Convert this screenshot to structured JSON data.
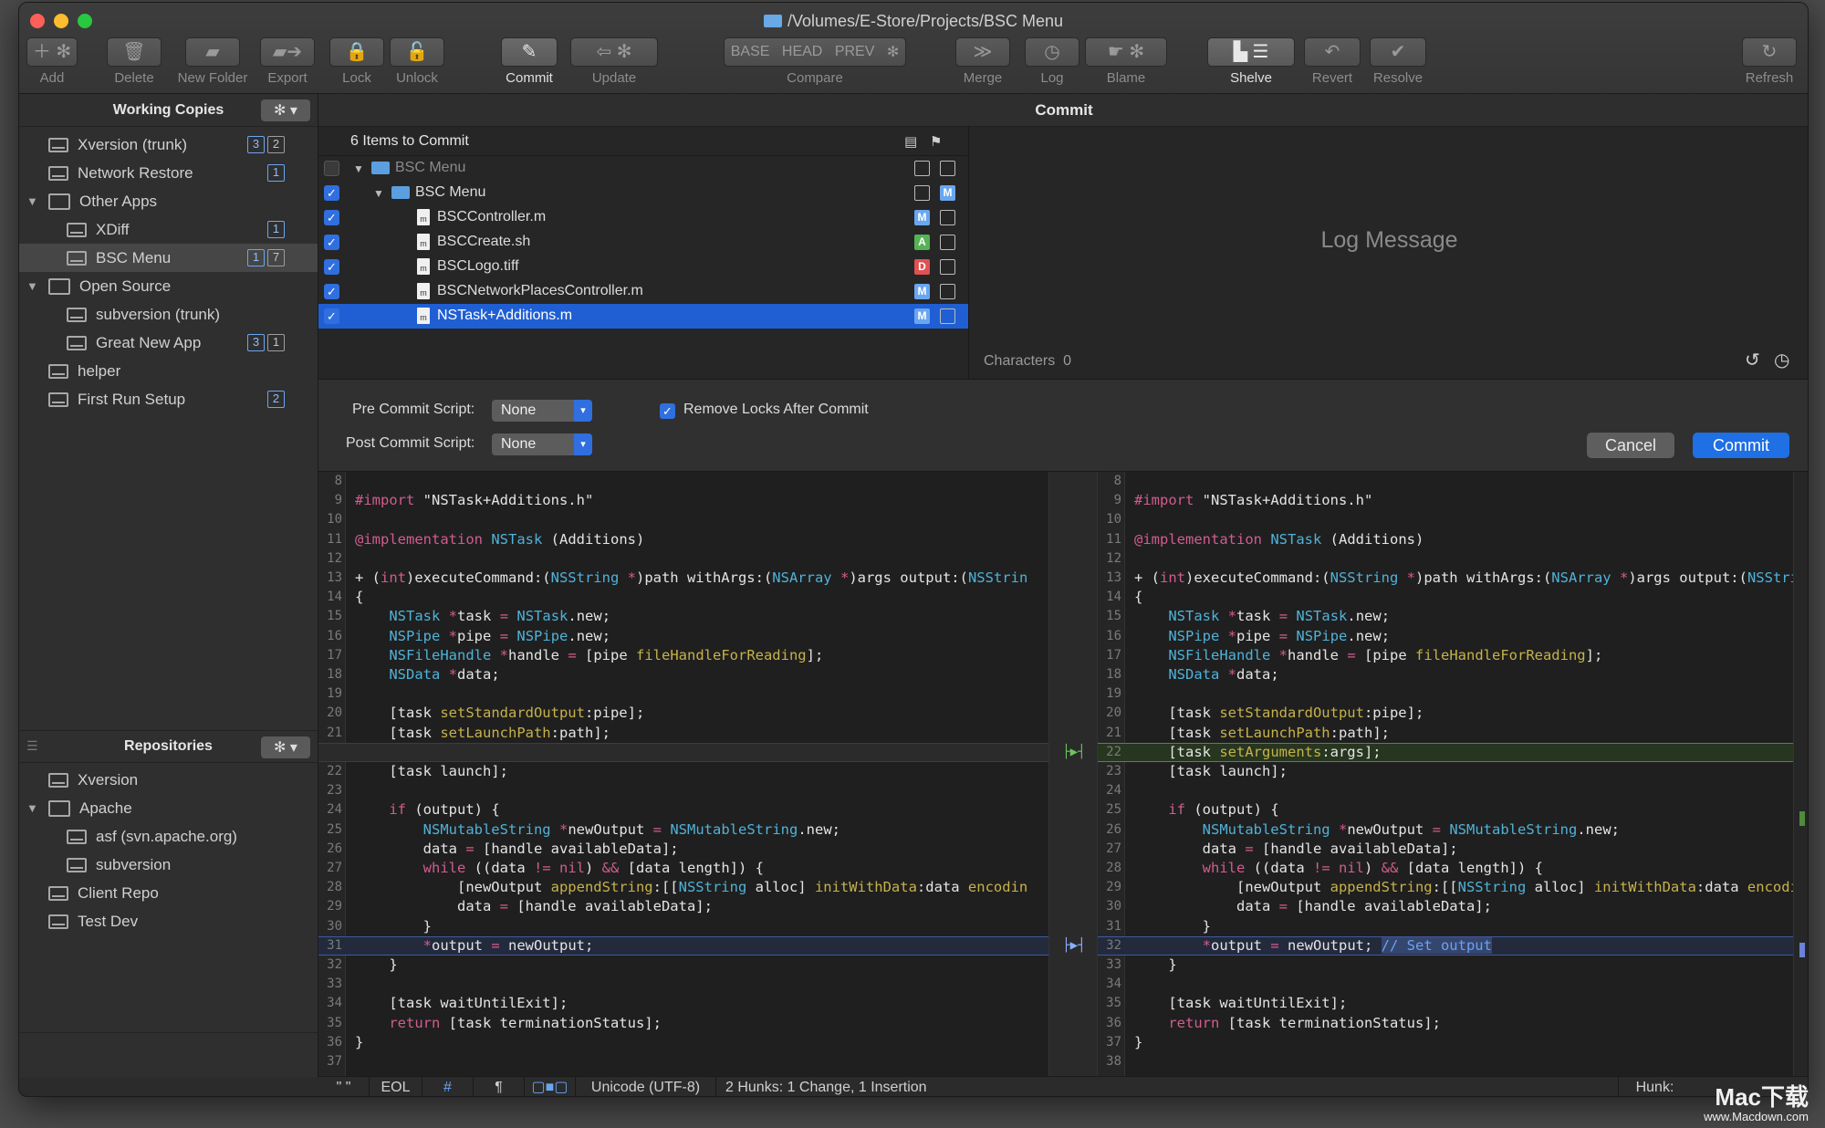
{
  "window": {
    "title": "/Volumes/E-Store/Projects/BSC Menu"
  },
  "toolbar": [
    {
      "id": "add",
      "label": "Add",
      "on": false
    },
    {
      "id": "delete",
      "label": "Delete",
      "on": false
    },
    {
      "id": "new_folder",
      "label": "New Folder",
      "on": false
    },
    {
      "id": "export",
      "label": "Export",
      "on": false
    },
    {
      "id": "lock",
      "label": "Lock",
      "on": false
    },
    {
      "id": "unlock",
      "label": "Unlock",
      "on": false
    },
    {
      "id": "commit",
      "label": "Commit",
      "on": true
    },
    {
      "id": "update",
      "label": "Update",
      "on": false
    },
    {
      "id": "compare",
      "label": "Compare",
      "on": false
    },
    {
      "id": "merge",
      "label": "Merge",
      "on": false
    },
    {
      "id": "log",
      "label": "Log",
      "on": false
    },
    {
      "id": "blame",
      "label": "Blame",
      "on": false
    },
    {
      "id": "shelve",
      "label": "Shelve",
      "on": true
    },
    {
      "id": "revert",
      "label": "Revert",
      "on": false
    },
    {
      "id": "resolve",
      "label": "Resolve",
      "on": false
    },
    {
      "id": "refresh",
      "label": "Refresh",
      "on": false
    }
  ],
  "compare_buttons": [
    "BASE",
    "HEAD",
    "PREV"
  ],
  "sidebar": {
    "working_copies_title": "Working Copies",
    "working_copies": [
      {
        "label": "Xversion (trunk)",
        "level": 0,
        "kind": "drive",
        "badges": [
          "3",
          "2"
        ],
        "disclosure": ""
      },
      {
        "label": "Network Restore",
        "level": 0,
        "kind": "drive",
        "badges": [
          "1"
        ],
        "disclosure": ""
      },
      {
        "label": "Other Apps",
        "level": 0,
        "kind": "folder",
        "badges": [],
        "disclosure": "▼"
      },
      {
        "label": "XDiff",
        "level": 1,
        "kind": "drive",
        "badges": [
          "1"
        ],
        "disclosure": ""
      },
      {
        "label": "BSC Menu",
        "level": 1,
        "kind": "drive",
        "badges": [
          "1",
          "7"
        ],
        "disclosure": "",
        "selected": true
      },
      {
        "label": "Open Source",
        "level": 0,
        "kind": "folder",
        "badges": [],
        "disclosure": "▼"
      },
      {
        "label": "subversion (trunk)",
        "level": 1,
        "kind": "drive",
        "badges": [],
        "disclosure": ""
      },
      {
        "label": "Great New App",
        "level": 1,
        "kind": "drive",
        "badges": [
          "3",
          "1"
        ],
        "disclosure": ""
      },
      {
        "label": "helper",
        "level": 0,
        "kind": "drive",
        "badges": [],
        "disclosure": ""
      },
      {
        "label": "First Run Setup",
        "level": 0,
        "kind": "drive",
        "badges": [
          "2"
        ],
        "disclosure": ""
      }
    ],
    "repositories_title": "Repositories",
    "repositories": [
      {
        "label": "Xversion",
        "level": 0,
        "kind": "drive",
        "disclosure": ""
      },
      {
        "label": "Apache",
        "level": 0,
        "kind": "folder",
        "disclosure": "▼"
      },
      {
        "label": "asf (svn.apache.org)",
        "level": 1,
        "kind": "drive",
        "disclosure": ""
      },
      {
        "label": "subversion",
        "level": 1,
        "kind": "drive",
        "disclosure": ""
      },
      {
        "label": "Client Repo",
        "level": 0,
        "kind": "drive",
        "disclosure": ""
      },
      {
        "label": "Test Dev",
        "level": 0,
        "kind": "drive",
        "disclosure": ""
      }
    ]
  },
  "main": {
    "title": "Commit",
    "items_header": "6 Items to Commit",
    "items": [
      {
        "name": "BSC Menu",
        "level": 0,
        "kind": "folder",
        "checked": false,
        "status": "",
        "dim": true
      },
      {
        "name": "BSC Menu",
        "level": 1,
        "kind": "folder",
        "checked": true,
        "status": "M",
        "status_col": 2
      },
      {
        "name": "BSCController.m",
        "level": 2,
        "kind": "file",
        "checked": true,
        "status": "M",
        "status_col": 1
      },
      {
        "name": "BSCCreate.sh",
        "level": 2,
        "kind": "file",
        "checked": true,
        "status": "A",
        "status_col": 1
      },
      {
        "name": "BSCLogo.tiff",
        "level": 2,
        "kind": "file",
        "checked": true,
        "status": "D",
        "status_col": 1
      },
      {
        "name": "BSCNetworkPlacesController.m",
        "level": 2,
        "kind": "file",
        "checked": true,
        "status": "M",
        "status_col": 1
      },
      {
        "name": "NSTask+Additions.m",
        "level": 2,
        "kind": "file",
        "checked": true,
        "status": "M",
        "status_col": 1,
        "selected": true
      }
    ],
    "log_placeholder": "Log Message",
    "characters_label": "Characters",
    "characters_count": "0",
    "pre_commit_label": "Pre Commit Script:",
    "pre_commit_value": "None",
    "post_commit_label": "Post Commit Script:",
    "post_commit_value": "None",
    "remove_locks_label": "Remove Locks After Commit",
    "cancel_label": "Cancel",
    "commit_label": "Commit"
  },
  "diff": {
    "left": [
      {
        "n": "8",
        "t": ""
      },
      {
        "n": "9",
        "t": "#import \"NSTask+Additions.h\""
      },
      {
        "n": "10",
        "t": ""
      },
      {
        "n": "11",
        "t": "@implementation NSTask (Additions)"
      },
      {
        "n": "12",
        "t": ""
      },
      {
        "n": "13",
        "t": "+ (int)executeCommand:(NSString *)path withArgs:(NSArray *)args output:(NSStrin"
      },
      {
        "n": "14",
        "t": "{"
      },
      {
        "n": "15",
        "t": "    NSTask *task = NSTask.new;"
      },
      {
        "n": "16",
        "t": "    NSPipe *pipe = NSPipe.new;"
      },
      {
        "n": "17",
        "t": "    NSFileHandle *handle = [pipe fileHandleForReading];"
      },
      {
        "n": "18",
        "t": "    NSData *data;"
      },
      {
        "n": "19",
        "t": ""
      },
      {
        "n": "20",
        "t": "    [task setStandardOutput:pipe];"
      },
      {
        "n": "21",
        "t": "    [task setLaunchPath:path];"
      },
      {
        "n": "",
        "t": "",
        "ph": true
      },
      {
        "n": "22",
        "t": "    [task launch];"
      },
      {
        "n": "23",
        "t": ""
      },
      {
        "n": "24",
        "t": "    if (output) {"
      },
      {
        "n": "25",
        "t": "        NSMutableString *newOutput = NSMutableString.new;"
      },
      {
        "n": "26",
        "t": "        data = [handle availableData];"
      },
      {
        "n": "27",
        "t": "        while ((data != nil) && [data length]) {"
      },
      {
        "n": "28",
        "t": "            [newOutput appendString:[[NSString alloc] initWithData:data encodin"
      },
      {
        "n": "29",
        "t": "            data = [handle availableData];"
      },
      {
        "n": "30",
        "t": "        }"
      },
      {
        "n": "31",
        "t": "        *output = newOutput;",
        "chg": true
      },
      {
        "n": "32",
        "t": "    }"
      },
      {
        "n": "33",
        "t": ""
      },
      {
        "n": "34",
        "t": "    [task waitUntilExit];"
      },
      {
        "n": "35",
        "t": "    return [task terminationStatus];"
      },
      {
        "n": "36",
        "t": "}"
      },
      {
        "n": "37",
        "t": ""
      }
    ],
    "right": [
      {
        "n": "8",
        "t": ""
      },
      {
        "n": "9",
        "t": "#import \"NSTask+Additions.h\""
      },
      {
        "n": "10",
        "t": ""
      },
      {
        "n": "11",
        "t": "@implementation NSTask (Additions)"
      },
      {
        "n": "12",
        "t": ""
      },
      {
        "n": "13",
        "t": "+ (int)executeCommand:(NSString *)path withArgs:(NSArray *)args output:(NSStrin"
      },
      {
        "n": "14",
        "t": "{"
      },
      {
        "n": "15",
        "t": "    NSTask *task = NSTask.new;"
      },
      {
        "n": "16",
        "t": "    NSPipe *pipe = NSPipe.new;"
      },
      {
        "n": "17",
        "t": "    NSFileHandle *handle = [pipe fileHandleForReading];"
      },
      {
        "n": "18",
        "t": "    NSData *data;"
      },
      {
        "n": "19",
        "t": ""
      },
      {
        "n": "20",
        "t": "    [task setStandardOutput:pipe];"
      },
      {
        "n": "21",
        "t": "    [task setLaunchPath:path];"
      },
      {
        "n": "22",
        "t": "    [task setArguments:args];",
        "ins": true
      },
      {
        "n": "23",
        "t": "    [task launch];"
      },
      {
        "n": "24",
        "t": ""
      },
      {
        "n": "25",
        "t": "    if (output) {"
      },
      {
        "n": "26",
        "t": "        NSMutableString *newOutput = NSMutableString.new;"
      },
      {
        "n": "27",
        "t": "        data = [handle availableData];"
      },
      {
        "n": "28",
        "t": "        while ((data != nil) && [data length]) {"
      },
      {
        "n": "29",
        "t": "            [newOutput appendString:[[NSString alloc] initWithData:data encodin"
      },
      {
        "n": "30",
        "t": "            data = [handle availableData];"
      },
      {
        "n": "31",
        "t": "        }"
      },
      {
        "n": "32",
        "t": "        *output = newOutput; // Set output",
        "chg": true
      },
      {
        "n": "33",
        "t": "    }"
      },
      {
        "n": "34",
        "t": ""
      },
      {
        "n": "35",
        "t": "    [task waitUntilExit];"
      },
      {
        "n": "36",
        "t": "    return [task terminationStatus];"
      },
      {
        "n": "37",
        "t": "}"
      },
      {
        "n": "38",
        "t": ""
      }
    ]
  },
  "status": {
    "quotes": "\" \"",
    "eol": "EOL",
    "hash": "#",
    "pilcrow": "¶",
    "encoding": "Unicode (UTF-8)",
    "hunks": "2 Hunks: 1 Change, 1 Insertion",
    "hunk_label": "Hunk:"
  },
  "watermark": {
    "brand": "Mac下载",
    "url": "www.Macdown.com"
  },
  "colors": {
    "accent": "#1f6fe5",
    "insert": "#4d8c3a",
    "change": "#3f5aa0"
  }
}
